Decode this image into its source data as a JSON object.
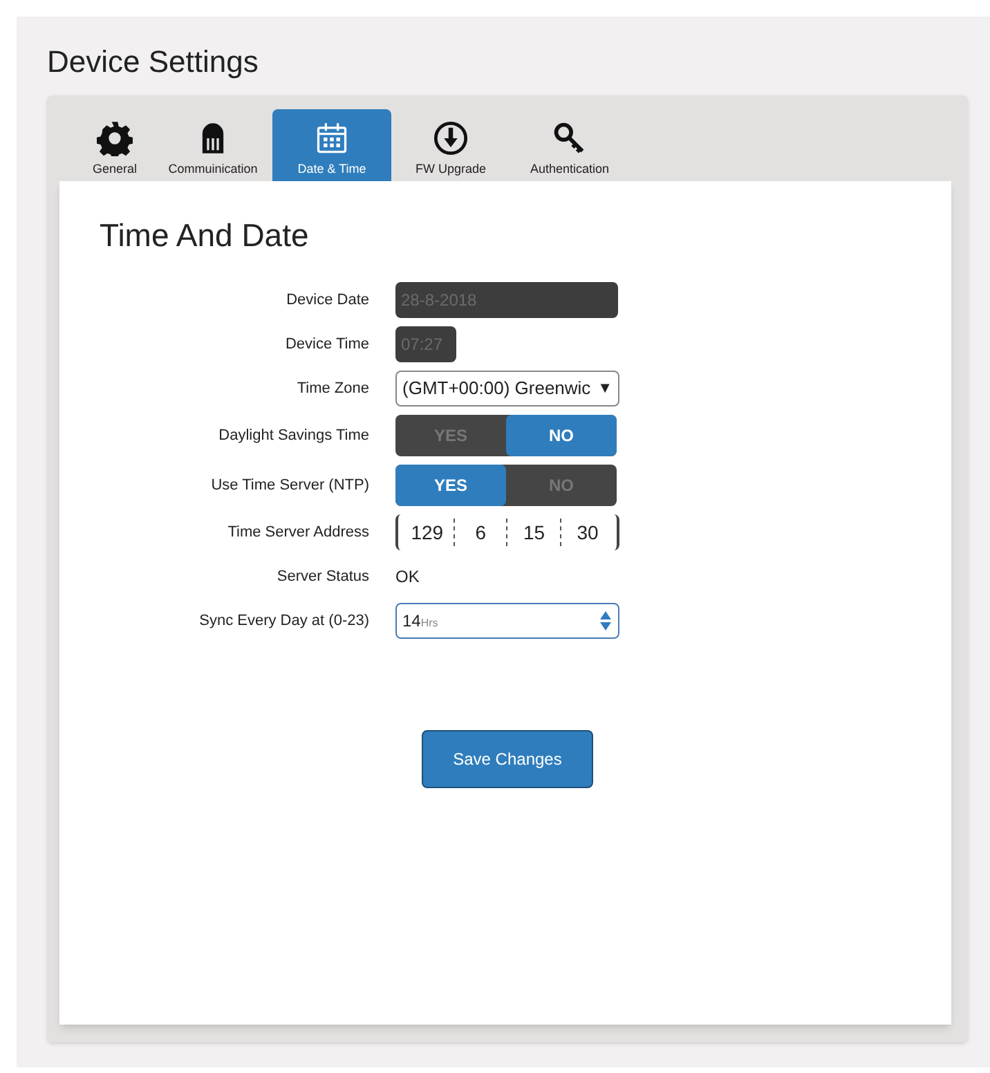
{
  "page_title": "Device Settings",
  "tabs": [
    {
      "label": "General",
      "selected": false
    },
    {
      "label": "Commuinication",
      "selected": false
    },
    {
      "label": "Date & Time",
      "selected": true
    },
    {
      "label": "FW Upgrade",
      "selected": false
    },
    {
      "label": "Authentication",
      "selected": false
    }
  ],
  "section_title": "Time And Date",
  "rows": [
    {
      "label": "Device Date",
      "kind": "readonly",
      "value": "28-8-2018",
      "disabled": true
    },
    {
      "label": "Device Time",
      "kind": "readonly",
      "value": "07:27",
      "disabled": true
    },
    {
      "label": "Time Zone",
      "kind": "select",
      "value": "(GMT+00:00) Greenwic",
      "caret": "▼"
    },
    {
      "label": "Daylight Savings Time",
      "kind": "toggle",
      "options": [
        {
          "label": "YES",
          "selected": false
        },
        {
          "label": "NO",
          "selected": true
        }
      ]
    },
    {
      "label": "Use Time Server (NTP)",
      "kind": "toggle",
      "options": [
        {
          "label": "YES",
          "selected": true
        },
        {
          "label": "NO",
          "selected": false
        }
      ]
    },
    {
      "label": "Time Server Address",
      "kind": "ip",
      "octets": [
        "129",
        "6",
        "15",
        "30"
      ]
    },
    {
      "label": "Server Status",
      "kind": "status",
      "value": "OK"
    },
    {
      "label": "Sync Every Day at (0-23)",
      "kind": "spinner",
      "value": "14",
      "unit": "Hrs"
    }
  ],
  "save_button": "Save Changes"
}
